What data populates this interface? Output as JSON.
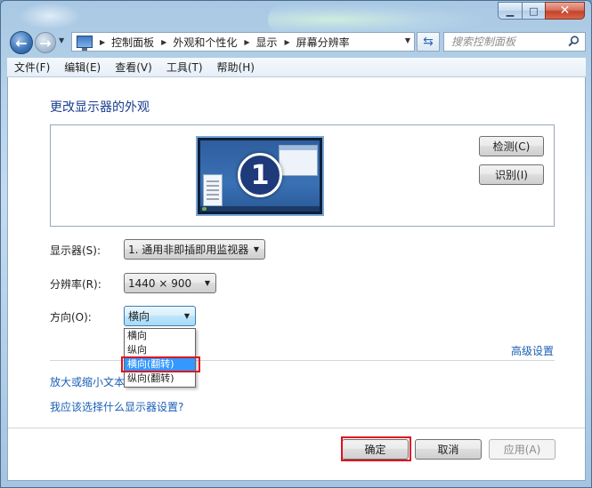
{
  "address": {
    "crumbs": [
      "控制面板",
      "外观和个性化",
      "显示",
      "屏幕分辨率"
    ]
  },
  "search": {
    "placeholder": "搜索控制面板"
  },
  "menu": [
    "文件(F)",
    "编辑(E)",
    "查看(V)",
    "工具(T)",
    "帮助(H)"
  ],
  "main": {
    "title": "更改显示器的外观",
    "monitor_number": "1",
    "detect_label": "检测(C)",
    "identify_label": "识别(I)",
    "display_label": "显示器(S):",
    "display_value": "1. 通用非即插即用监视器",
    "resolution_label": "分辨率(R):",
    "resolution_value": "1440 × 900",
    "orientation_label": "方向(O):",
    "orientation_value": "横向",
    "orientation_options": [
      "横向",
      "纵向",
      "横向(翻转)",
      "纵向(翻转)"
    ],
    "orientation_selected_index": 2,
    "advanced_link": "高级设置",
    "zoom_link": "放大或缩小文本",
    "help_link": "我应该选择什么显示器设置?"
  },
  "footer": {
    "ok_label": "确定",
    "cancel_label": "取消",
    "apply_label": "应用(A)"
  },
  "colors": {
    "title_blue": "#1a3d8f",
    "link_blue": "#1a5fb4",
    "selection_blue": "#3399ff",
    "highlight_red": "#e01020"
  }
}
